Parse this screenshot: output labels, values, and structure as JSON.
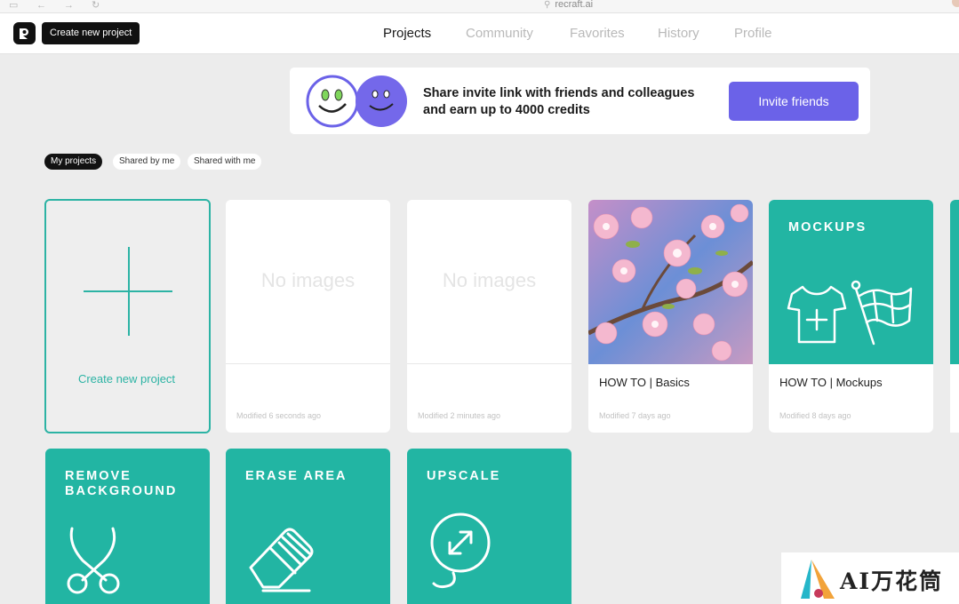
{
  "browser": {
    "url": "recraft.ai"
  },
  "header": {
    "create_button": "Create new project",
    "tabs": [
      {
        "label": "Projects",
        "active": true
      },
      {
        "label": "Community",
        "active": false
      },
      {
        "label": "Favorites",
        "active": false
      },
      {
        "label": "History",
        "active": false
      },
      {
        "label": "Profile",
        "active": false
      }
    ]
  },
  "banner": {
    "text": "Share invite link with friends and colleagues and earn up to 4000 credits",
    "button": "Invite friends"
  },
  "filters": [
    {
      "label": "My projects",
      "active": true
    },
    {
      "label": "Shared by me",
      "active": false
    },
    {
      "label": "Shared with me",
      "active": false
    }
  ],
  "create_card": {
    "label": "Create new project"
  },
  "projects": [
    {
      "placeholder": "No images",
      "title": "",
      "modified": "Modified 6 seconds ago"
    },
    {
      "placeholder": "No images",
      "title": "",
      "modified": "Modified 2 minutes ago"
    },
    {
      "thumb": "cherry-blossom-photo",
      "title": "HOW TO | Basics",
      "modified": "Modified 7 days ago"
    },
    {
      "thumb": "mockups-tile",
      "thumb_label": "MOCKUPS",
      "title": "HOW TO | Mockups",
      "modified": "Modified 8 days ago"
    }
  ],
  "tools": [
    {
      "label": "REMOVE\nBACKGROUND",
      "icon": "scissors-icon"
    },
    {
      "label": "ERASE AREA",
      "icon": "eraser-icon"
    },
    {
      "label": "UPSCALE",
      "icon": "upscale-icon"
    }
  ],
  "watermark": {
    "text": "AI万花筒"
  },
  "colors": {
    "teal": "#22b5a3",
    "purple": "#6b62e8",
    "dark": "#121212"
  }
}
